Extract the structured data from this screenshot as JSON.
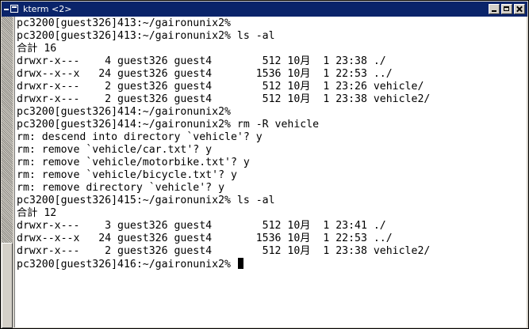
{
  "window": {
    "title": "kterm <2>"
  },
  "terminal": {
    "lines": [
      "pc3200[guest326]413:~/gaironunix2%",
      "pc3200[guest326]413:~/gaironunix2% ls -al",
      "合計 16",
      "drwxr-x---    4 guest326 guest4        512 10月  1 23:38 ./",
      "drwx--x--x   24 guest326 guest4       1536 10月  1 22:53 ../",
      "drwxr-x---    2 guest326 guest4        512 10月  1 23:26 vehicle/",
      "drwxr-x---    2 guest326 guest4        512 10月  1 23:38 vehicle2/",
      "pc3200[guest326]414:~/gaironunix2%",
      "pc3200[guest326]414:~/gaironunix2% rm -R vehicle",
      "rm: descend into directory `vehicle'? y",
      "rm: remove `vehicle/car.txt'? y",
      "rm: remove `vehicle/motorbike.txt'? y",
      "rm: remove `vehicle/bicycle.txt'? y",
      "rm: remove directory `vehicle'? y",
      "pc3200[guest326]415:~/gaironunix2% ls -al",
      "合計 12",
      "drwxr-x---    3 guest326 guest4        512 10月  1 23:41 ./",
      "drwx--x--x   24 guest326 guest4       1536 10月  1 22:53 ../",
      "drwxr-x---    2 guest326 guest4        512 10月  1 23:38 vehicle2/"
    ],
    "prompt": "pc3200[guest326]416:~/gaironunix2% "
  },
  "scrollbar": {
    "position_fraction": 0.73
  },
  "colors": {
    "titlebar": "#0a246a",
    "terminal_bg": "#ffffff",
    "text": "#000000",
    "chrome": "#d4d0c8"
  }
}
